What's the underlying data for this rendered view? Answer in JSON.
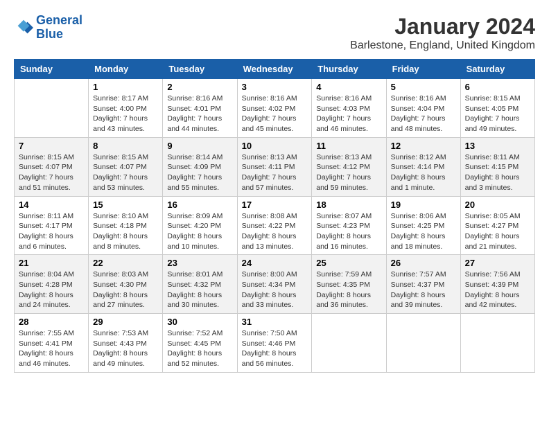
{
  "header": {
    "logo_line1": "General",
    "logo_line2": "Blue",
    "month": "January 2024",
    "location": "Barlestone, England, United Kingdom"
  },
  "days_of_week": [
    "Sunday",
    "Monday",
    "Tuesday",
    "Wednesday",
    "Thursday",
    "Friday",
    "Saturday"
  ],
  "weeks": [
    [
      {
        "day": "",
        "info": ""
      },
      {
        "day": "1",
        "info": "Sunrise: 8:17 AM\nSunset: 4:00 PM\nDaylight: 7 hours\nand 43 minutes."
      },
      {
        "day": "2",
        "info": "Sunrise: 8:16 AM\nSunset: 4:01 PM\nDaylight: 7 hours\nand 44 minutes."
      },
      {
        "day": "3",
        "info": "Sunrise: 8:16 AM\nSunset: 4:02 PM\nDaylight: 7 hours\nand 45 minutes."
      },
      {
        "day": "4",
        "info": "Sunrise: 8:16 AM\nSunset: 4:03 PM\nDaylight: 7 hours\nand 46 minutes."
      },
      {
        "day": "5",
        "info": "Sunrise: 8:16 AM\nSunset: 4:04 PM\nDaylight: 7 hours\nand 48 minutes."
      },
      {
        "day": "6",
        "info": "Sunrise: 8:15 AM\nSunset: 4:05 PM\nDaylight: 7 hours\nand 49 minutes."
      }
    ],
    [
      {
        "day": "7",
        "info": ""
      },
      {
        "day": "8",
        "info": "Sunrise: 8:15 AM\nSunset: 4:07 PM\nDaylight: 7 hours\nand 53 minutes."
      },
      {
        "day": "9",
        "info": "Sunrise: 8:14 AM\nSunset: 4:09 PM\nDaylight: 7 hours\nand 55 minutes."
      },
      {
        "day": "10",
        "info": "Sunrise: 8:13 AM\nSunset: 4:11 PM\nDaylight: 7 hours\nand 57 minutes."
      },
      {
        "day": "11",
        "info": "Sunrise: 8:13 AM\nSunset: 4:12 PM\nDaylight: 7 hours\nand 59 minutes."
      },
      {
        "day": "12",
        "info": "Sunrise: 8:12 AM\nSunset: 4:14 PM\nDaylight: 8 hours\nand 1 minute."
      },
      {
        "day": "13",
        "info": "Sunrise: 8:11 AM\nSunset: 4:15 PM\nDaylight: 8 hours\nand 3 minutes."
      }
    ],
    [
      {
        "day": "14",
        "info": "Sunrise: 8:11 AM\nSunset: 4:17 PM\nDaylight: 8 hours\nand 6 minutes."
      },
      {
        "day": "15",
        "info": "Sunrise: 8:10 AM\nSunset: 4:18 PM\nDaylight: 8 hours\nand 8 minutes."
      },
      {
        "day": "16",
        "info": "Sunrise: 8:09 AM\nSunset: 4:20 PM\nDaylight: 8 hours\nand 10 minutes."
      },
      {
        "day": "17",
        "info": "Sunrise: 8:08 AM\nSunset: 4:22 PM\nDaylight: 8 hours\nand 13 minutes."
      },
      {
        "day": "18",
        "info": "Sunrise: 8:07 AM\nSunset: 4:23 PM\nDaylight: 8 hours\nand 16 minutes."
      },
      {
        "day": "19",
        "info": "Sunrise: 8:06 AM\nSunset: 4:25 PM\nDaylight: 8 hours\nand 18 minutes."
      },
      {
        "day": "20",
        "info": "Sunrise: 8:05 AM\nSunset: 4:27 PM\nDaylight: 8 hours\nand 21 minutes."
      }
    ],
    [
      {
        "day": "21",
        "info": "Sunrise: 8:04 AM\nSunset: 4:28 PM\nDaylight: 8 hours\nand 24 minutes."
      },
      {
        "day": "22",
        "info": "Sunrise: 8:03 AM\nSunset: 4:30 PM\nDaylight: 8 hours\nand 27 minutes."
      },
      {
        "day": "23",
        "info": "Sunrise: 8:01 AM\nSunset: 4:32 PM\nDaylight: 8 hours\nand 30 minutes."
      },
      {
        "day": "24",
        "info": "Sunrise: 8:00 AM\nSunset: 4:34 PM\nDaylight: 8 hours\nand 33 minutes."
      },
      {
        "day": "25",
        "info": "Sunrise: 7:59 AM\nSunset: 4:35 PM\nDaylight: 8 hours\nand 36 minutes."
      },
      {
        "day": "26",
        "info": "Sunrise: 7:57 AM\nSunset: 4:37 PM\nDaylight: 8 hours\nand 39 minutes."
      },
      {
        "day": "27",
        "info": "Sunrise: 7:56 AM\nSunset: 4:39 PM\nDaylight: 8 hours\nand 42 minutes."
      }
    ],
    [
      {
        "day": "28",
        "info": "Sunrise: 7:55 AM\nSunset: 4:41 PM\nDaylight: 8 hours\nand 46 minutes."
      },
      {
        "day": "29",
        "info": "Sunrise: 7:53 AM\nSunset: 4:43 PM\nDaylight: 8 hours\nand 49 minutes."
      },
      {
        "day": "30",
        "info": "Sunrise: 7:52 AM\nSunset: 4:45 PM\nDaylight: 8 hours\nand 52 minutes."
      },
      {
        "day": "31",
        "info": "Sunrise: 7:50 AM\nSunset: 4:46 PM\nDaylight: 8 hours\nand 56 minutes."
      },
      {
        "day": "",
        "info": ""
      },
      {
        "day": "",
        "info": ""
      },
      {
        "day": "",
        "info": ""
      }
    ]
  ],
  "week7_sunday": "Sunrise: 8:15 AM\nSunset: 4:07 PM\nDaylight: 7 hours\nand 51 minutes."
}
